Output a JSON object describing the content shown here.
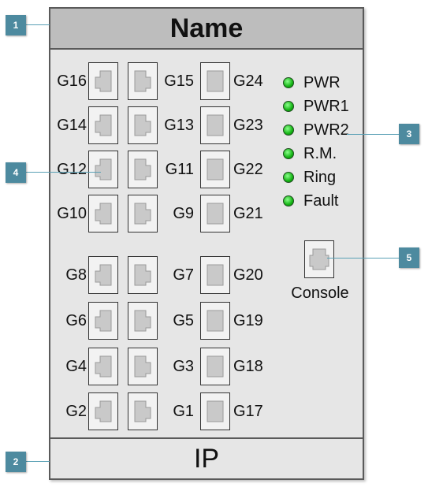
{
  "device": {
    "name": "Name",
    "ip": "IP"
  },
  "ports": [
    {
      "label": "G16",
      "row": 0,
      "col": 0
    },
    {
      "label": "G15",
      "row": 0,
      "col": 1
    },
    {
      "label": "G24",
      "row": 0,
      "col": 2
    },
    {
      "label": "G14",
      "row": 1,
      "col": 0
    },
    {
      "label": "G13",
      "row": 1,
      "col": 1
    },
    {
      "label": "G23",
      "row": 1,
      "col": 2
    },
    {
      "label": "G12",
      "row": 2,
      "col": 0
    },
    {
      "label": "G11",
      "row": 2,
      "col": 1
    },
    {
      "label": "G22",
      "row": 2,
      "col": 2
    },
    {
      "label": "G10",
      "row": 3,
      "col": 0
    },
    {
      "label": "G9",
      "row": 3,
      "col": 1
    },
    {
      "label": "G21",
      "row": 3,
      "col": 2
    },
    {
      "label": "G8",
      "row": 4,
      "col": 0
    },
    {
      "label": "G7",
      "row": 4,
      "col": 1
    },
    {
      "label": "G20",
      "row": 4,
      "col": 2
    },
    {
      "label": "G6",
      "row": 5,
      "col": 0
    },
    {
      "label": "G5",
      "row": 5,
      "col": 1
    },
    {
      "label": "G19",
      "row": 5,
      "col": 2
    },
    {
      "label": "G4",
      "row": 6,
      "col": 0
    },
    {
      "label": "G3",
      "row": 6,
      "col": 1
    },
    {
      "label": "G18",
      "row": 6,
      "col": 2
    },
    {
      "label": "G2",
      "row": 7,
      "col": 0
    },
    {
      "label": "G1",
      "row": 7,
      "col": 1
    },
    {
      "label": "G17",
      "row": 7,
      "col": 2
    }
  ],
  "leds": [
    {
      "label": "PWR",
      "color": "#14b414"
    },
    {
      "label": "PWR1",
      "color": "#14b414"
    },
    {
      "label": "PWR2",
      "color": "#14b414"
    },
    {
      "label": "R.M.",
      "color": "#14b414"
    },
    {
      "label": "Ring",
      "color": "#14b414"
    },
    {
      "label": "Fault",
      "color": "#14b414"
    }
  ],
  "console": {
    "label": "Console"
  },
  "callouts": [
    "1",
    "2",
    "3",
    "4",
    "5"
  ],
  "colors": {
    "callout": "#4d8a9f",
    "header": "#bdbdbd",
    "panel": "#e6e6e6"
  }
}
